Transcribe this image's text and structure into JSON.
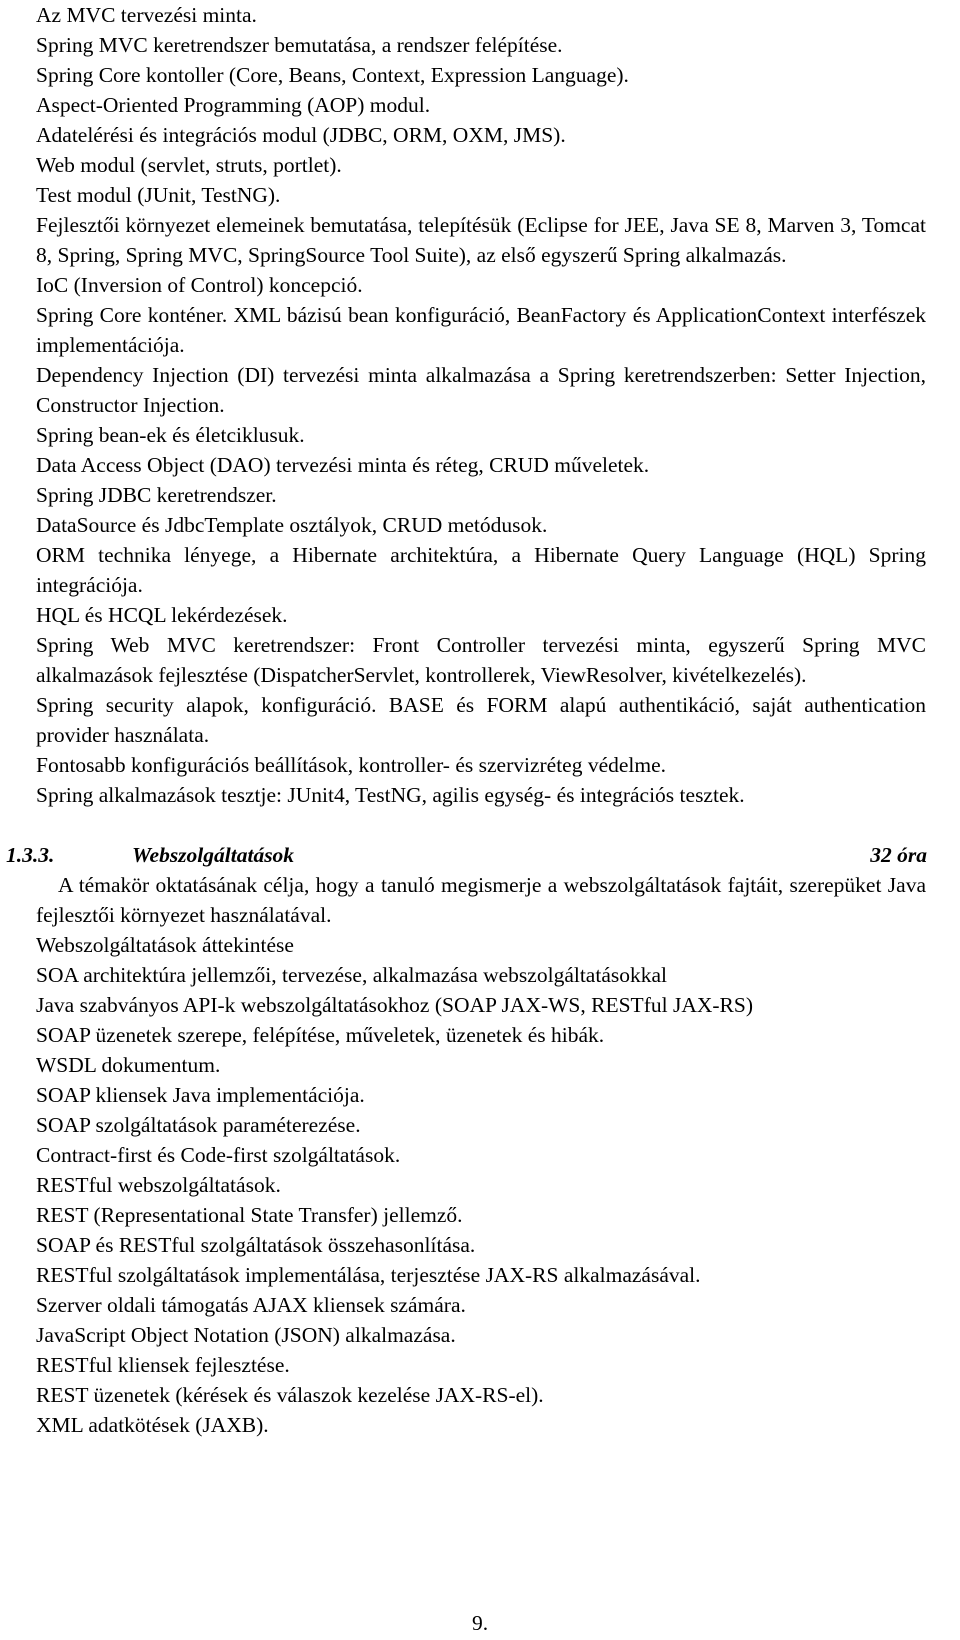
{
  "document": {
    "language": "hu",
    "page_number_label": "9.",
    "text_color": "#000000",
    "background_color": "#ffffff"
  },
  "block_spring": {
    "lines": [
      "Az MVC tervezési minta.",
      "Spring MVC keretrendszer bemutatása, a rendszer felépítése.",
      "Spring Core kontoller (Core, Beans, Context, Expression Language).",
      "Aspect-Oriented Programming (AOP) modul.",
      "Adatelérési és integrációs modul (JDBC, ORM, OXM, JMS).",
      "Web modul (servlet, struts, portlet).",
      "Test modul (JUnit, TestNG)."
    ],
    "para_fejlesztoi": "Fejlesztői környezet elemeinek bemutatása, telepítésük (Eclipse for JEE, Java SE 8, Marven 3, Tomcat 8, Spring, Spring MVC, SpringSource Tool Suite), az első egyszerű Spring alkalmazás.",
    "line_ioc": "IoC (Inversion of Control) koncepció.",
    "para_core": "Spring Core konténer. XML bázisú bean konfiguráció, BeanFactory és ApplicationContext interfészek implementációja.",
    "para_di": "Dependency Injection (DI) tervezési minta alkalmazása a Spring keretrendszerben: Setter Injection, Constructor Injection.",
    "lines_mid": [
      "Spring bean-ek és életciklusuk.",
      "Data Access Object (DAO) tervezési minta és réteg, CRUD műveletek.",
      "Spring JDBC keretrendszer.",
      "DataSource és JdbcTemplate osztályok, CRUD metódusok."
    ],
    "para_orm": "ORM technika lényege, a Hibernate architektúra, a Hibernate Query Language (HQL) Spring integrációja.",
    "line_hql": "HQL és HCQL lekérdezések.",
    "para_webmvc": "Spring Web MVC keretrendszer: Front Controller tervezési minta, egyszerű Spring MVC alkalmazások fejlesztése (DispatcherServlet, kontrollerek, ViewResolver, kivételkezelés).",
    "para_security": "Spring security alapok, konfiguráció. BASE és FORM alapú authentikáció, saját authentication provider használata.",
    "lines_end": [
      "Fontosabb konfigurációs beállítások, kontroller- és szervizréteg védelme.",
      "Spring alkalmazások tesztje: JUnit4, TestNG, agilis egység- és integrációs tesztek."
    ]
  },
  "section_heading": {
    "number": "1.3.3.",
    "title": "Webszolgáltatások",
    "hours": "32 óra"
  },
  "block_webservices": {
    "para_intro": "A témakör oktatásának célja, hogy a tanuló megismerje a webszolgáltatások fajtáit, szerepüket Java fejlesztői környezet használatával.",
    "lines": [
      "Webszolgáltatások áttekintése",
      "SOA architektúra jellemzői, tervezése, alkalmazása webszolgáltatásokkal",
      "Java szabványos API-k webszolgáltatásokhoz (SOAP JAX-WS, RESTful JAX-RS)",
      "SOAP üzenetek szerepe, felépítése, műveletek, üzenetek és hibák.",
      "WSDL dokumentum.",
      "SOAP kliensek Java implementációja.",
      "SOAP szolgáltatások paraméterezése.",
      "Contract-first és Code-first szolgáltatások.",
      "RESTful webszolgáltatások.",
      "REST (Representational State Transfer) jellemző.",
      "SOAP és RESTful szolgáltatások összehasonlítása.",
      "RESTful szolgáltatások implementálása, terjesztése JAX-RS alkalmazásával.",
      "Szerver oldali támogatás AJAX kliensek számára.",
      "JavaScript Object Notation (JSON) alkalmazása.",
      "RESTful kliensek fejlesztése.",
      "REST üzenetek (kérések és válaszok kezelése JAX-RS-el).",
      "XML adatkötések (JAXB)."
    ]
  }
}
